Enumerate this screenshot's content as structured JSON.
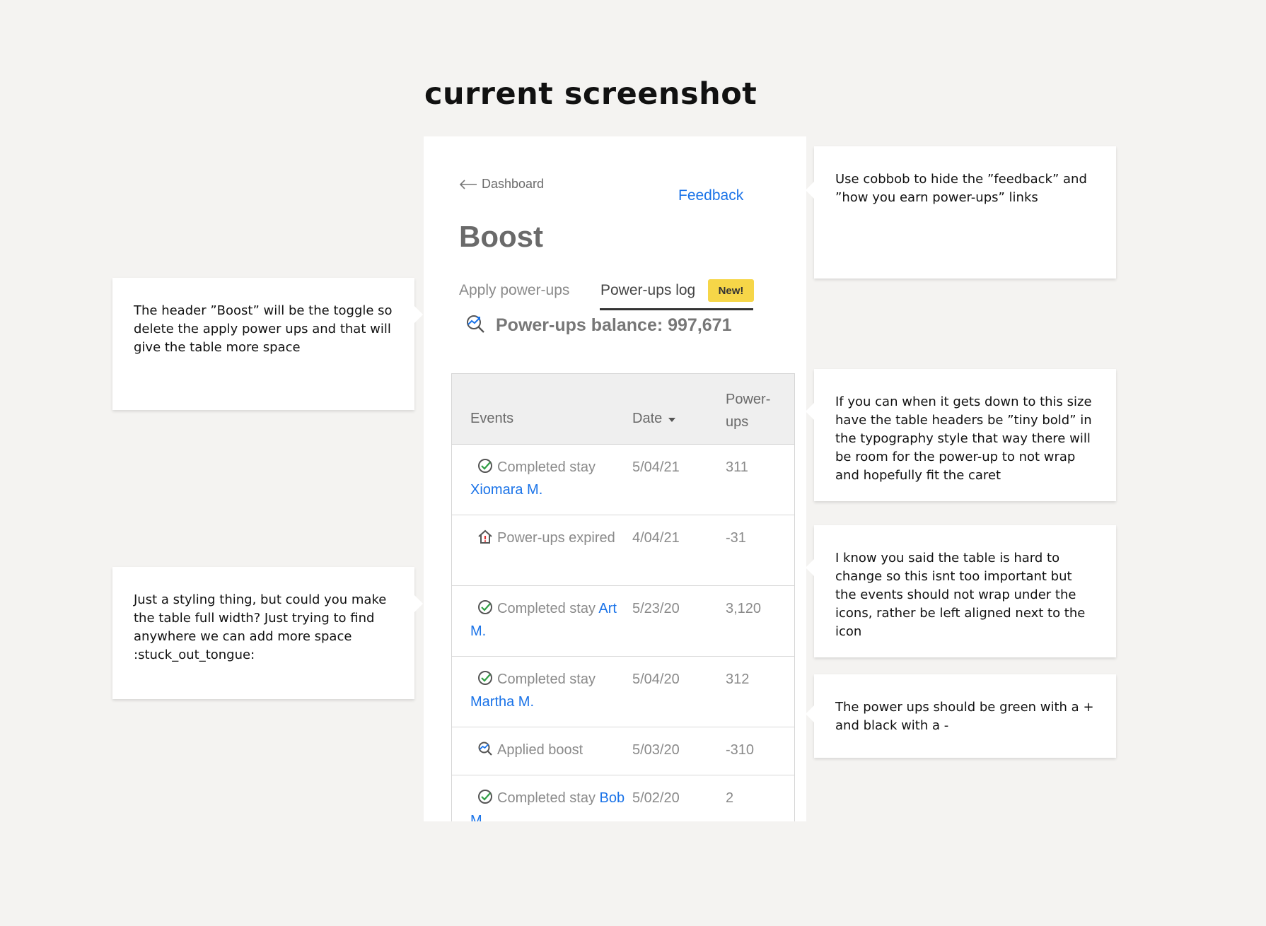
{
  "page_title": "current screenshot",
  "mock": {
    "back_label": "Dashboard",
    "feedback_label": "Feedback",
    "title": "Boost",
    "tabs": [
      {
        "label": "Apply power-ups"
      },
      {
        "label": "Power-ups log"
      }
    ],
    "badge": "New!",
    "balance": "Power-ups balance: 997,671",
    "table": {
      "headers": {
        "events": "Events",
        "date": "Date",
        "power": "Power-ups"
      },
      "rows": [
        {
          "icon": "check-circle-icon",
          "event": "Completed stay",
          "guest": "Xiomara M.",
          "date": "5/04/21",
          "points": "311"
        },
        {
          "icon": "house-alert-icon",
          "event": "Power-ups expired",
          "guest": "",
          "date": "4/04/21",
          "points": "-31"
        },
        {
          "icon": "check-circle-icon",
          "event": "Completed stay",
          "guest": "Art M.",
          "date": "5/23/20",
          "points": "3,120"
        },
        {
          "icon": "check-circle-icon",
          "event": "Completed stay",
          "guest": "Martha M.",
          "date": "5/04/20",
          "points": "312"
        },
        {
          "icon": "boost-magnifier-icon",
          "event": "Applied boost",
          "guest": "",
          "date": "5/03/20",
          "points": "-310"
        },
        {
          "icon": "check-circle-icon",
          "event": "Completed stay",
          "guest": "Bob M.",
          "date": "5/02/20",
          "points": "2"
        }
      ]
    }
  },
  "notes": [
    "Use cobbob to hide the ”feedback” and ”how you earn power-ups” links",
    "The header ”Boost” will be the toggle so delete the apply power ups and that will give the table more space",
    "If you can when it gets down to this size have the table headers be ”tiny bold” in the typography style that way there will be room for the power-up to not wrap and hopefully fit the caret",
    "I know you said the table is hard to change so this isnt too important but the events should not wrap under the icons, rather be left aligned next to the icon",
    "Just a styling thing, but could you make the table full width? Just trying to find anywhere we can add more space :stuck_out_tongue:",
    "The power ups should be green with a + and black with a -"
  ],
  "colors": {
    "link": "#1a73e8",
    "badge": "#f6d648",
    "check": "#2f9e44",
    "background": "#f4f3f1"
  }
}
